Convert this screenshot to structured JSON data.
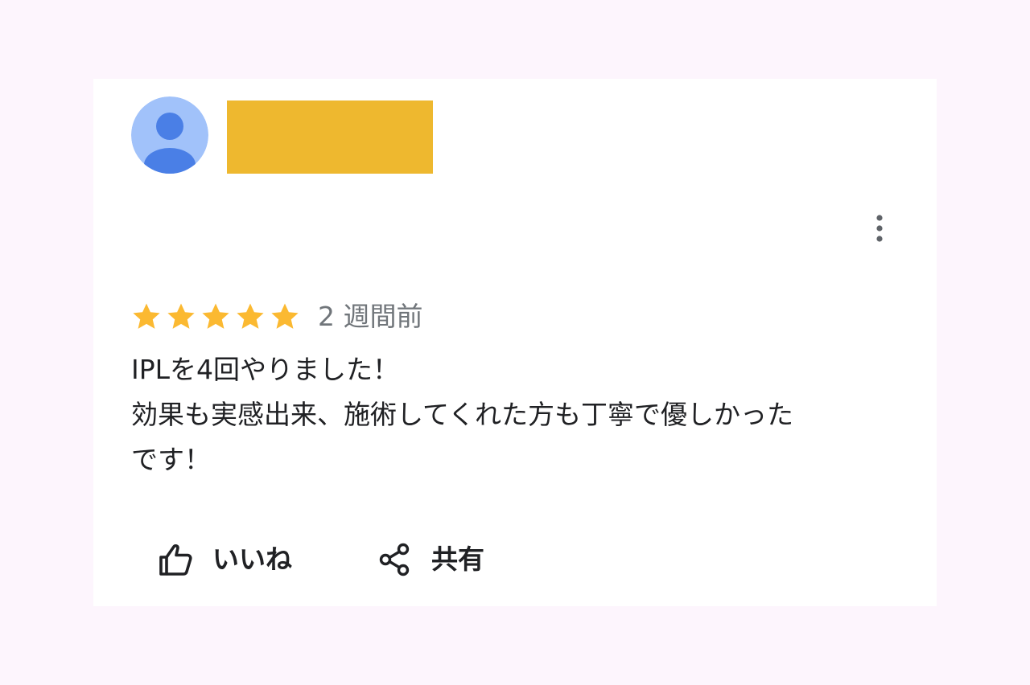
{
  "review": {
    "author_avatar_icon": "default-user-avatar-icon",
    "author_name_redacted_color": "#eeb82f",
    "more_options_icon": "more-vert-icon",
    "rating": 5,
    "rating_max": 5,
    "star_color": "#fbb931",
    "time_ago": "2 週間前",
    "text_lines": [
      "IPLを4回やりました！",
      "効果も実感出来、施術してくれた方も丁寧で優しかった",
      "です！"
    ]
  },
  "actions": {
    "like_label": "いいね",
    "like_icon": "thumb-up-icon",
    "share_label": "共有",
    "share_icon": "share-icon"
  },
  "colors": {
    "page_background": "#fdf5fd",
    "card_background": "#ffffff",
    "avatar_background": "#a1c2fa",
    "avatar_figure": "#4a7fe6",
    "secondary_text": "#70757a",
    "primary_text": "#202124"
  }
}
